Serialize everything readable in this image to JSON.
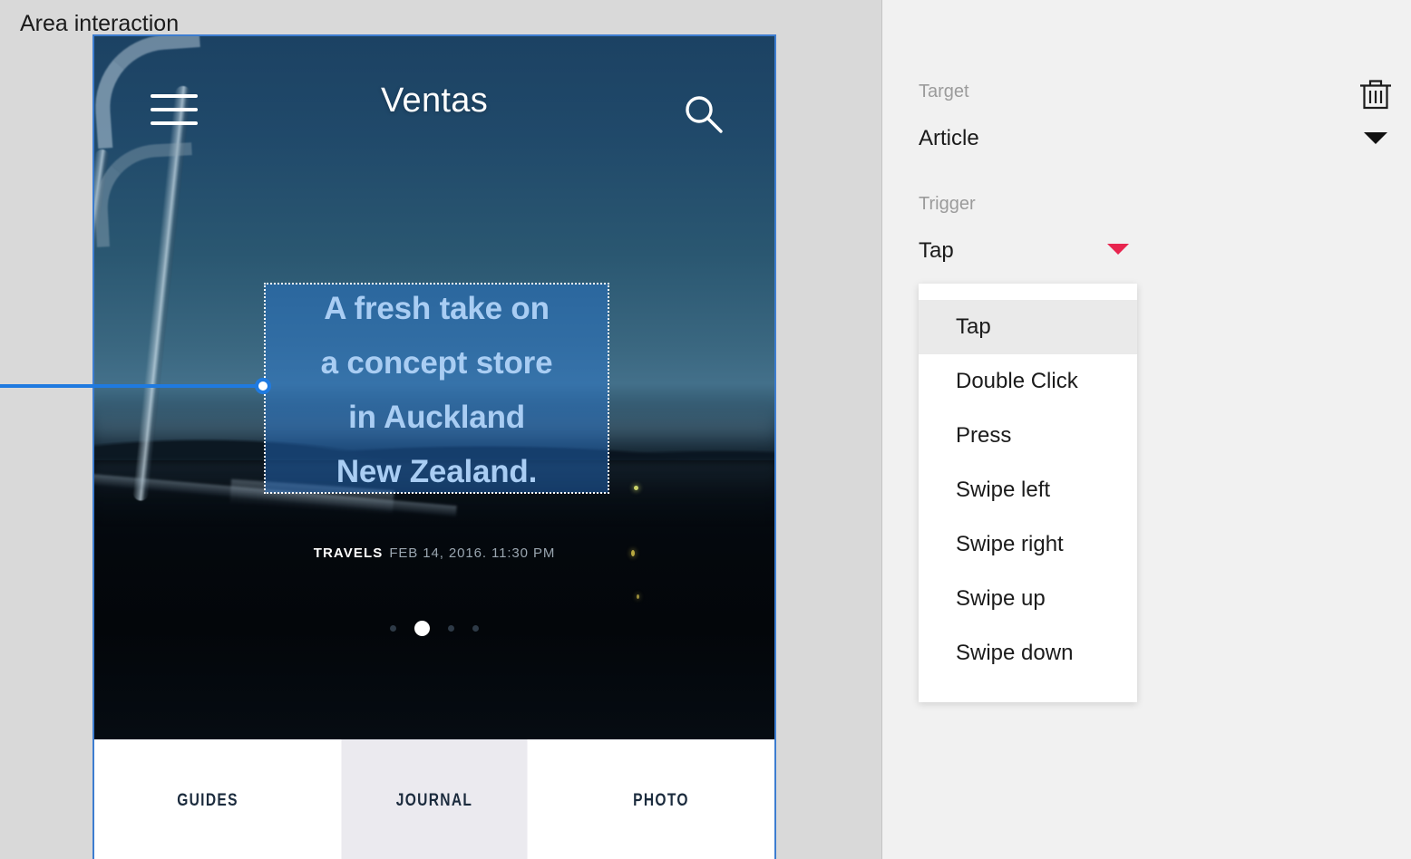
{
  "panel": {
    "title": "Area interaction",
    "delete_icon": "trash-icon",
    "target": {
      "label": "Target",
      "value": "Article",
      "caret_color": "#111111"
    },
    "trigger": {
      "label": "Trigger",
      "value": "Tap",
      "caret_color": "#e8254f"
    },
    "dropdown": {
      "selected": "Tap",
      "options": [
        "Tap",
        "Double Click",
        "Press",
        "Swipe left",
        "Swipe right",
        "Swipe up",
        "Swipe down"
      ]
    }
  },
  "preview": {
    "header": {
      "menu_icon": "hamburger-menu-icon",
      "title": "Ventas",
      "search_icon": "search-icon"
    },
    "headline": "A fresh take on\na concept store\nin Auckland\nNew Zealand.",
    "meta": {
      "category": "TRAVELS",
      "date": "FEB 14, 2016. 11:30 PM"
    },
    "carousel": {
      "dots": 4,
      "active_index": 1
    },
    "tabs": [
      {
        "label": "GUIDES",
        "active": false
      },
      {
        "label": "JOURNAL",
        "active": true
      },
      {
        "label": "PHOTO",
        "active": false
      }
    ]
  },
  "colors": {
    "canvas_bg": "#d9d9d9",
    "panel_bg": "#f1f1f1",
    "selection_blue": "#1f7ae0",
    "frame_border": "#3d7dd0",
    "accent_pink": "#e8254f",
    "headline_text": "#a9cdf3"
  }
}
